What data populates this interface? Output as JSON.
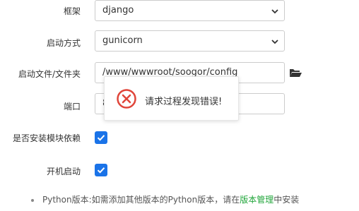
{
  "form": {
    "framework": {
      "label": "框架",
      "value": "django"
    },
    "startup_mode": {
      "label": "启动方式",
      "value": "gunicorn"
    },
    "startup_file": {
      "label": "启动文件/文件夹",
      "value": "/www/wwwroot/soogor/config"
    },
    "port": {
      "label": "端口",
      "value": "8"
    },
    "install_deps": {
      "label": "是否安装模块依赖",
      "checked": true
    },
    "autostart": {
      "label": "开机启动",
      "checked": true
    }
  },
  "note": {
    "prefix": "Python版本:如需添加其他版本的Python版本，请在",
    "link": "版本管理",
    "suffix": "中安装"
  },
  "toast": {
    "message": "请求过程发现错误!"
  },
  "icons": {
    "select_chevron": "chevron-down-icon",
    "folder": "folder-open-icon",
    "error": "error-x-icon",
    "check": "checkmark-icon"
  },
  "colors": {
    "checkbox": "#1a73e8",
    "error": "#e0453a",
    "link": "#20a53a"
  }
}
